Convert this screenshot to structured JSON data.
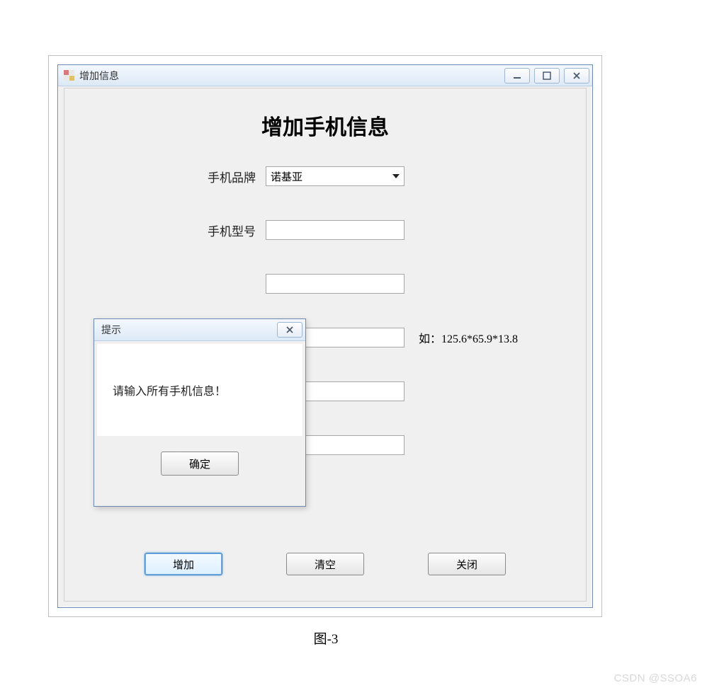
{
  "window": {
    "title": "增加信息",
    "controls": {
      "minimize": "minimize",
      "maximize": "maximize",
      "close": "close"
    }
  },
  "form": {
    "header": "增加手机信息",
    "brand_label": "手机品牌",
    "brand_selected": "诺基亚",
    "model_label": "手机型号",
    "model_value": "",
    "field3_value": "",
    "field4_value": "",
    "size_hint": "如：125.6*65.9*13.8",
    "field5_value": "",
    "field6_value": ""
  },
  "buttons": {
    "add": "增加",
    "clear": "清空",
    "close": "关闭"
  },
  "dialog": {
    "title": "提示",
    "message": "请输入所有手机信息！",
    "ok": "确定"
  },
  "caption": "图-3",
  "watermark": "CSDN @SSOA6"
}
